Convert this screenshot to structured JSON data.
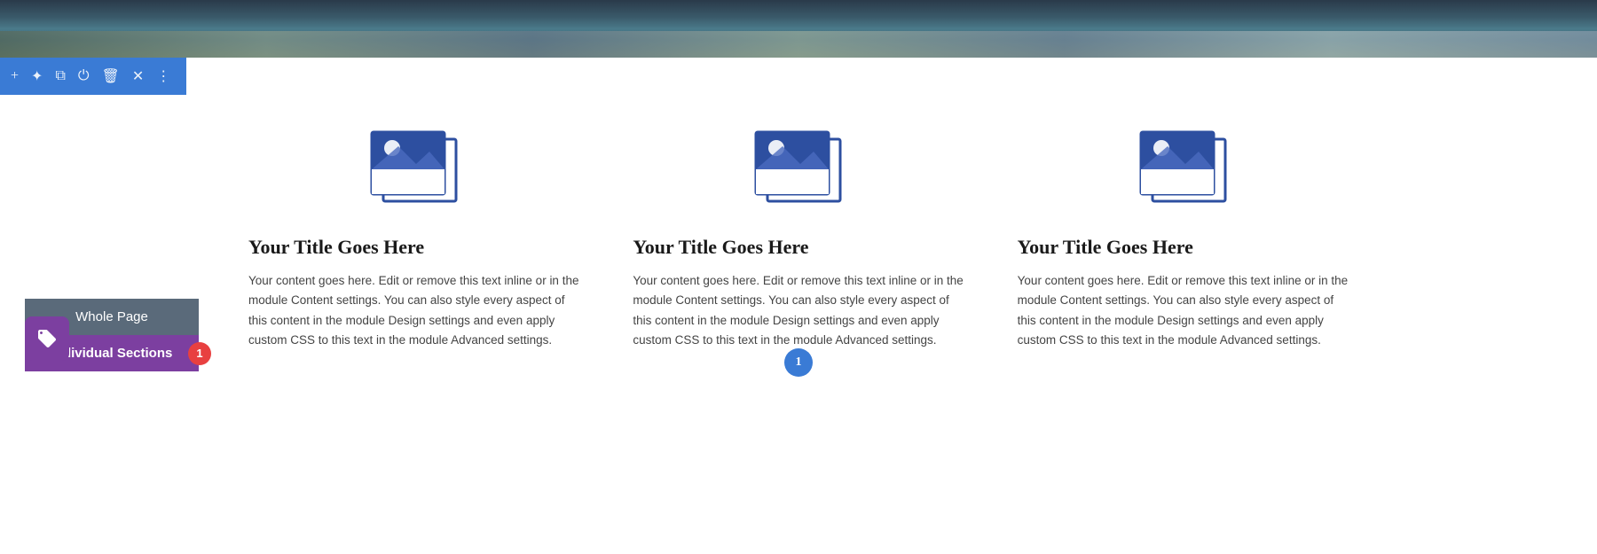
{
  "banner": {
    "alt": "landscape photo banner"
  },
  "toolbar": {
    "icons": [
      {
        "name": "plus",
        "symbol": "+"
      },
      {
        "name": "settings",
        "symbol": "✦"
      },
      {
        "name": "duplicate",
        "symbol": "⧉"
      },
      {
        "name": "power",
        "symbol": "⏻"
      },
      {
        "name": "trash",
        "symbol": "🗑"
      },
      {
        "name": "close",
        "symbol": "✕"
      },
      {
        "name": "more",
        "symbol": "⋮"
      }
    ]
  },
  "columns": [
    {
      "title": "Your Title Goes Here",
      "text": "Your content goes here. Edit or remove this text inline or in the module Content settings. You can also style every aspect of this content in the module Design settings and even apply custom CSS to this text in the module Advanced settings."
    },
    {
      "title": "Your Title Goes Here",
      "text": "Your content goes here. Edit or remove this text inline or in the module Content settings. You can also style every aspect of this content in the module Design settings and even apply custom CSS to this text in the module Advanced settings."
    },
    {
      "title": "Your Title Goes Here",
      "text": "Your content goes here. Edit or remove this text inline or in the module Content settings. You can also style every aspect of this content in the module Design settings and even apply custom CSS to this text in the module Advanced settings."
    }
  ],
  "side_buttons": {
    "whole_page": "Whole Page",
    "individual_sections": "Individual Sections",
    "badge": "1"
  },
  "fab": {
    "icon": "tag"
  },
  "pagination": {
    "current": "1"
  }
}
